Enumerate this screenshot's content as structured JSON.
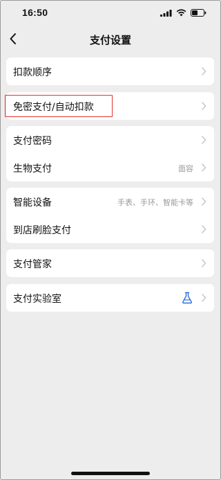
{
  "status_bar": {
    "time": "16:50"
  },
  "nav": {
    "title": "支付设置"
  },
  "groups": [
    {
      "items": [
        {
          "label": "扣款顺序"
        }
      ]
    },
    {
      "items": [
        {
          "label": "免密支付/自动扣款"
        }
      ]
    },
    {
      "items": [
        {
          "label": "支付密码"
        },
        {
          "label": "生物支付",
          "value": "面容"
        }
      ]
    },
    {
      "items": [
        {
          "label": "智能设备",
          "value": "手表、手环、智能卡等"
        },
        {
          "label": "到店刷脸支付"
        }
      ]
    },
    {
      "items": [
        {
          "label": "支付管家"
        }
      ]
    },
    {
      "items": [
        {
          "label": "支付实验室",
          "icon": "flask-icon"
        }
      ]
    }
  ],
  "colors": {
    "highlight": "#e0322c",
    "accent": "#2f6fe0"
  }
}
